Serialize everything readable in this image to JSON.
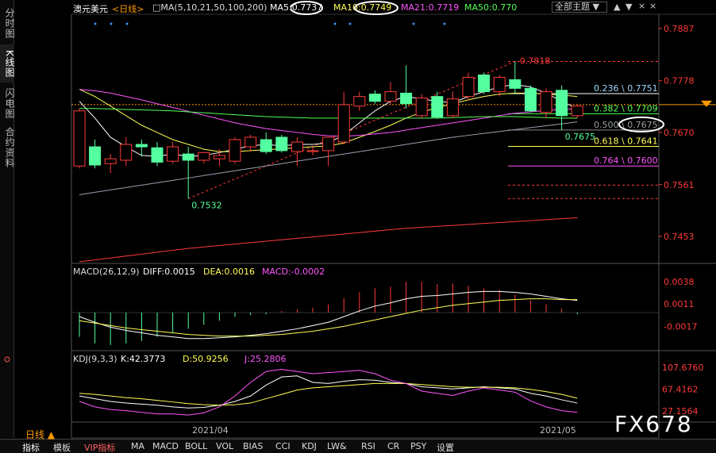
{
  "instrument": "澳元美元",
  "period_tag": "<日线>",
  "ma_header": {
    "label": "MA(5,10,21,50,100,200)",
    "items": [
      {
        "name": "MA5",
        "value": "0.7737",
        "color": "#ffffff"
      },
      {
        "name": "MA10",
        "value": "0.7749",
        "color": "#ffff55"
      },
      {
        "name": "MA21",
        "value": "0.7719",
        "color": "#ff55ff"
      },
      {
        "name": "MA50",
        "value": "0.770",
        "color": "#55ff55"
      }
    ]
  },
  "top_buttons": {
    "theme": "全部主题",
    "up": "▲",
    "down": "▼",
    "close": "×"
  },
  "side_tabs": [
    "分时图",
    "K线图",
    "闪电图",
    "合约资料"
  ],
  "macd_header": {
    "label": "MACD(26,12,9)",
    "diff": "DIFF:0.0015",
    "dea": "DEA:0.0016",
    "macd": "MACD:-0.0002"
  },
  "kdj_header": {
    "label": "KDJ(9,3,3)",
    "k": "K:42.3773",
    "d": "D:50.9256",
    "j": "J:25.2806"
  },
  "toolbar": {
    "period": "日线 ▲",
    "items": [
      "指标",
      "模板",
      "VIP指标",
      "MA",
      "MACD",
      "BOLL",
      "VOL",
      "BIAS",
      "CCI",
      "KDJ",
      "LW&",
      "RSI",
      "CR",
      "PSY",
      "设置"
    ]
  },
  "watermark": "FX678",
  "colors": {
    "up": "#ff3a3a",
    "down": "#54ff9f",
    "ma5": "#ffffff",
    "ma10": "#ffff55",
    "ma21": "#ff55ff",
    "ma50": "#55ff55",
    "fib_dash": "#ff3a3a",
    "accent": "#ff9900"
  },
  "chart_data": {
    "type": "candlestick",
    "price_axis": {
      "ticks": [
        "0.7887",
        "0.7778",
        "0.7670",
        "0.7561",
        "0.7453"
      ],
      "range": [
        0.74,
        0.791
      ]
    },
    "macd_axis": {
      "ticks": [
        "0.0038",
        "0.0011",
        "-0.0017"
      ],
      "range": [
        -0.0045,
        0.0045
      ]
    },
    "kdj_axis": {
      "ticks": [
        "107.6760",
        "67.4162",
        "27.1564"
      ],
      "range": [
        10,
        115
      ]
    },
    "date_labels": [
      "2021/04",
      "2021/05"
    ],
    "candles": [
      {
        "o": 0.76,
        "h": 0.772,
        "l": 0.7595,
        "c": 0.7715
      },
      {
        "o": 0.764,
        "h": 0.7655,
        "l": 0.7595,
        "c": 0.7602
      },
      {
        "o": 0.7605,
        "h": 0.7625,
        "l": 0.7585,
        "c": 0.7615
      },
      {
        "o": 0.7612,
        "h": 0.766,
        "l": 0.76,
        "c": 0.7645
      },
      {
        "o": 0.7645,
        "h": 0.7655,
        "l": 0.762,
        "c": 0.764
      },
      {
        "o": 0.7638,
        "h": 0.765,
        "l": 0.76,
        "c": 0.7608
      },
      {
        "o": 0.761,
        "h": 0.765,
        "l": 0.7605,
        "c": 0.764
      },
      {
        "o": 0.7625,
        "h": 0.764,
        "l": 0.7532,
        "c": 0.7612
      },
      {
        "o": 0.7612,
        "h": 0.763,
        "l": 0.7605,
        "c": 0.7628
      },
      {
        "o": 0.7615,
        "h": 0.7635,
        "l": 0.76,
        "c": 0.7622
      },
      {
        "o": 0.761,
        "h": 0.766,
        "l": 0.7605,
        "c": 0.7655
      },
      {
        "o": 0.764,
        "h": 0.7665,
        "l": 0.763,
        "c": 0.766
      },
      {
        "o": 0.7655,
        "h": 0.767,
        "l": 0.7625,
        "c": 0.763
      },
      {
        "o": 0.766,
        "h": 0.7665,
        "l": 0.7628,
        "c": 0.7632
      },
      {
        "o": 0.763,
        "h": 0.766,
        "l": 0.76,
        "c": 0.765
      },
      {
        "o": 0.763,
        "h": 0.764,
        "l": 0.7622,
        "c": 0.7632
      },
      {
        "o": 0.7632,
        "h": 0.766,
        "l": 0.76,
        "c": 0.766
      },
      {
        "o": 0.765,
        "h": 0.7755,
        "l": 0.7645,
        "c": 0.7728
      },
      {
        "o": 0.7725,
        "h": 0.7755,
        "l": 0.7715,
        "c": 0.7745
      },
      {
        "o": 0.775,
        "h": 0.7758,
        "l": 0.773,
        "c": 0.7735
      },
      {
        "o": 0.7735,
        "h": 0.7775,
        "l": 0.7728,
        "c": 0.7755
      },
      {
        "o": 0.7752,
        "h": 0.781,
        "l": 0.772,
        "c": 0.773
      },
      {
        "o": 0.7705,
        "h": 0.775,
        "l": 0.77,
        "c": 0.7742
      },
      {
        "o": 0.7745,
        "h": 0.7755,
        "l": 0.7698,
        "c": 0.7702
      },
      {
        "o": 0.7705,
        "h": 0.7755,
        "l": 0.77,
        "c": 0.774
      },
      {
        "o": 0.7745,
        "h": 0.7795,
        "l": 0.7738,
        "c": 0.7785
      },
      {
        "o": 0.779,
        "h": 0.7795,
        "l": 0.775,
        "c": 0.7755
      },
      {
        "o": 0.7755,
        "h": 0.779,
        "l": 0.7745,
        "c": 0.7785
      },
      {
        "o": 0.778,
        "h": 0.7818,
        "l": 0.775,
        "c": 0.7762
      },
      {
        "o": 0.7762,
        "h": 0.7768,
        "l": 0.7712,
        "c": 0.7715
      },
      {
        "o": 0.7712,
        "h": 0.7762,
        "l": 0.77,
        "c": 0.7755
      },
      {
        "o": 0.7758,
        "h": 0.7768,
        "l": 0.7675,
        "c": 0.7705
      },
      {
        "o": 0.7705,
        "h": 0.773,
        "l": 0.77,
        "c": 0.7725
      }
    ],
    "ma_lines": [
      {
        "name": "MA5",
        "values": [
          0.7735,
          0.77,
          0.766,
          0.764,
          0.7622,
          0.762,
          0.7625,
          0.762,
          0.7622,
          0.7628,
          0.7635,
          0.7642,
          0.7645,
          0.7642,
          0.7645,
          0.7645,
          0.7648,
          0.7665,
          0.769,
          0.7715,
          0.7735,
          0.7745,
          0.774,
          0.7735,
          0.7732,
          0.7745,
          0.7755,
          0.7765,
          0.777,
          0.7765,
          0.7752,
          0.7735,
          0.772
        ]
      },
      {
        "name": "MA10",
        "values": [
          0.776,
          0.7745,
          0.7725,
          0.7705,
          0.7685,
          0.767,
          0.7655,
          0.7645,
          0.7635,
          0.763,
          0.763,
          0.7632,
          0.7634,
          0.7636,
          0.7638,
          0.764,
          0.7642,
          0.7648,
          0.766,
          0.7672,
          0.7685,
          0.77,
          0.7712,
          0.7722,
          0.773,
          0.7738,
          0.7745,
          0.775,
          0.7752,
          0.7752,
          0.775,
          0.7748,
          0.7745
        ]
      },
      {
        "name": "MA21",
        "values": [
          0.776,
          0.7757,
          0.7752,
          0.7745,
          0.7738,
          0.773,
          0.7722,
          0.7714,
          0.7706,
          0.7698,
          0.769,
          0.7684,
          0.7678,
          0.7674,
          0.767,
          0.7666,
          0.7663,
          0.7662,
          0.7664,
          0.7667,
          0.767,
          0.7675,
          0.768,
          0.7685,
          0.769,
          0.7695,
          0.77,
          0.7705,
          0.771,
          0.7713,
          0.7716,
          0.7718,
          0.7719
        ]
      },
      {
        "name": "MA50",
        "values": [
          0.772,
          0.772,
          0.7719,
          0.7718,
          0.7717,
          0.7716,
          0.7715,
          0.7713,
          0.7711,
          0.7709,
          0.7707,
          0.7705,
          0.7703,
          0.7702,
          0.7701,
          0.77,
          0.77,
          0.77,
          0.77,
          0.77,
          0.77,
          0.77,
          0.77,
          0.77,
          0.7701,
          0.7702,
          0.7703,
          0.7703,
          0.7703,
          0.7702,
          0.7701,
          0.77,
          0.77
        ]
      },
      {
        "name": "MA100",
        "values": [
          0.754,
          0.7545,
          0.755,
          0.7555,
          0.756,
          0.7565,
          0.757,
          0.7575,
          0.758,
          0.7585,
          0.759,
          0.7595,
          0.76,
          0.7605,
          0.761,
          0.7615,
          0.762,
          0.7625,
          0.763,
          0.7635,
          0.764,
          0.7645,
          0.765,
          0.7655,
          0.766,
          0.7664,
          0.7668,
          0.7672,
          0.7676,
          0.768,
          0.7684,
          0.7688,
          0.7692
        ]
      },
      {
        "name": "MA200",
        "values": [
          0.74,
          0.7404,
          0.7408,
          0.7412,
          0.7416,
          0.742,
          0.7424,
          0.7428,
          0.7431,
          0.7434,
          0.7437,
          0.744,
          0.7443,
          0.7446,
          0.7449,
          0.7452,
          0.7455,
          0.7458,
          0.7461,
          0.7464,
          0.7467,
          0.747,
          0.7472,
          0.7474,
          0.7476,
          0.7478,
          0.748,
          0.7482,
          0.7484,
          0.7486,
          0.7488,
          0.749,
          0.7492
        ]
      }
    ],
    "annotations": [
      {
        "label": "0.7532",
        "price": 0.7532,
        "candle": 7
      },
      {
        "label": "0.7818",
        "price": 0.7818,
        "candle": 28
      },
      {
        "label": "0.7675",
        "price": 0.7675,
        "candle": 31
      }
    ],
    "fib_levels": [
      {
        "label": "0.236 \\ 0.7751",
        "price": 0.7751,
        "color": "#ffffff",
        "label_color": "#a0d8ff"
      },
      {
        "label": "0.382 \\ 0.7709",
        "price": 0.7709,
        "color": "#55ff55",
        "label_color": "#55ff55"
      },
      {
        "label": "0.500 \\ 0.7675",
        "price": 0.7675,
        "color": "#888888",
        "label_color": "#9aa0a0"
      },
      {
        "label": "0.618 \\ 0.7641",
        "price": 0.7641,
        "color": "#ffff55",
        "label_color": "#ffff55"
      },
      {
        "label": "0.764 \\ 0.7600",
        "price": 0.76,
        "color": "#ff55ff",
        "label_color": "#ff55ff"
      }
    ],
    "fib_dashed_levels": [
      0.7818,
      0.7532
    ],
    "macd": {
      "hist": [
        -0.003,
        -0.0038,
        -0.004,
        -0.0038,
        -0.0035,
        -0.003,
        -0.0025,
        -0.002,
        -0.0015,
        -0.001,
        -0.0005,
        -0.0003,
        -0.0002,
        0.0002,
        0.0004,
        0.0006,
        0.001,
        0.0018,
        0.0025,
        0.003,
        0.0032,
        0.0038,
        0.0038,
        0.0035,
        0.0036,
        0.0033,
        0.003,
        0.0028,
        0.0022,
        0.0015,
        0.001,
        0.0005,
        -0.0002
      ],
      "diff": [
        -0.0005,
        -0.0012,
        -0.0018,
        -0.0022,
        -0.0025,
        -0.0028,
        -0.003,
        -0.0032,
        -0.0032,
        -0.0031,
        -0.003,
        -0.0028,
        -0.0026,
        -0.0023,
        -0.002,
        -0.0016,
        -0.0012,
        -0.0005,
        0.0002,
        0.0008,
        0.0012,
        0.0017,
        0.002,
        0.0021,
        0.0023,
        0.0025,
        0.0026,
        0.0026,
        0.0025,
        0.0023,
        0.002,
        0.0017,
        0.0015
      ],
      "dea": [
        -0.001,
        -0.0013,
        -0.0016,
        -0.0019,
        -0.0021,
        -0.0023,
        -0.0025,
        -0.0027,
        -0.0028,
        -0.0029,
        -0.0029,
        -0.0029,
        -0.0028,
        -0.0027,
        -0.0025,
        -0.0023,
        -0.002,
        -0.0017,
        -0.0013,
        -0.0009,
        -0.0005,
        -0.0001,
        0.0003,
        0.0006,
        0.0009,
        0.0011,
        0.0013,
        0.0015,
        0.0016,
        0.0017,
        0.0017,
        0.0016,
        0.0016
      ]
    },
    "kdj": {
      "k": [
        55,
        50,
        45,
        42,
        40,
        38,
        35,
        33,
        34,
        38,
        45,
        55,
        75,
        90,
        92,
        80,
        78,
        82,
        85,
        84,
        80,
        78,
        72,
        70,
        68,
        70,
        72,
        70,
        68,
        60,
        55,
        48,
        42
      ],
      "d": [
        60,
        58,
        55,
        52,
        50,
        47,
        44,
        41,
        39,
        38,
        39,
        42,
        50,
        58,
        66,
        70,
        72,
        74,
        76,
        78,
        78,
        78,
        76,
        74,
        72,
        71,
        71,
        71,
        70,
        67,
        63,
        58,
        51
      ],
      "j": [
        45,
        35,
        30,
        28,
        25,
        22,
        22,
        20,
        24,
        35,
        55,
        80,
        100,
        104,
        100,
        96,
        98,
        100,
        102,
        96,
        84,
        78,
        64,
        60,
        56,
        64,
        70,
        66,
        62,
        46,
        35,
        28,
        25
      ]
    }
  }
}
